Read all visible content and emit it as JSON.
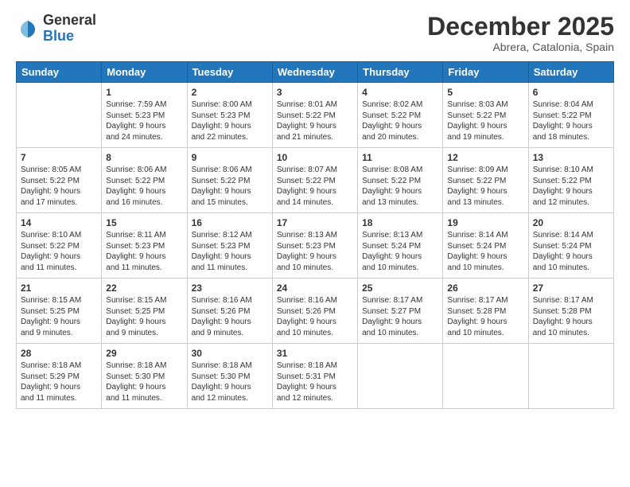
{
  "header": {
    "logo_general": "General",
    "logo_blue": "Blue",
    "month": "December 2025",
    "location": "Abrera, Catalonia, Spain"
  },
  "days_of_week": [
    "Sunday",
    "Monday",
    "Tuesday",
    "Wednesday",
    "Thursday",
    "Friday",
    "Saturday"
  ],
  "weeks": [
    [
      {
        "num": "",
        "info": ""
      },
      {
        "num": "1",
        "info": "Sunrise: 7:59 AM\nSunset: 5:23 PM\nDaylight: 9 hours\nand 24 minutes."
      },
      {
        "num": "2",
        "info": "Sunrise: 8:00 AM\nSunset: 5:23 PM\nDaylight: 9 hours\nand 22 minutes."
      },
      {
        "num": "3",
        "info": "Sunrise: 8:01 AM\nSunset: 5:22 PM\nDaylight: 9 hours\nand 21 minutes."
      },
      {
        "num": "4",
        "info": "Sunrise: 8:02 AM\nSunset: 5:22 PM\nDaylight: 9 hours\nand 20 minutes."
      },
      {
        "num": "5",
        "info": "Sunrise: 8:03 AM\nSunset: 5:22 PM\nDaylight: 9 hours\nand 19 minutes."
      },
      {
        "num": "6",
        "info": "Sunrise: 8:04 AM\nSunset: 5:22 PM\nDaylight: 9 hours\nand 18 minutes."
      }
    ],
    [
      {
        "num": "7",
        "info": "Sunrise: 8:05 AM\nSunset: 5:22 PM\nDaylight: 9 hours\nand 17 minutes."
      },
      {
        "num": "8",
        "info": "Sunrise: 8:06 AM\nSunset: 5:22 PM\nDaylight: 9 hours\nand 16 minutes."
      },
      {
        "num": "9",
        "info": "Sunrise: 8:06 AM\nSunset: 5:22 PM\nDaylight: 9 hours\nand 15 minutes."
      },
      {
        "num": "10",
        "info": "Sunrise: 8:07 AM\nSunset: 5:22 PM\nDaylight: 9 hours\nand 14 minutes."
      },
      {
        "num": "11",
        "info": "Sunrise: 8:08 AM\nSunset: 5:22 PM\nDaylight: 9 hours\nand 13 minutes."
      },
      {
        "num": "12",
        "info": "Sunrise: 8:09 AM\nSunset: 5:22 PM\nDaylight: 9 hours\nand 13 minutes."
      },
      {
        "num": "13",
        "info": "Sunrise: 8:10 AM\nSunset: 5:22 PM\nDaylight: 9 hours\nand 12 minutes."
      }
    ],
    [
      {
        "num": "14",
        "info": "Sunrise: 8:10 AM\nSunset: 5:22 PM\nDaylight: 9 hours\nand 11 minutes."
      },
      {
        "num": "15",
        "info": "Sunrise: 8:11 AM\nSunset: 5:23 PM\nDaylight: 9 hours\nand 11 minutes."
      },
      {
        "num": "16",
        "info": "Sunrise: 8:12 AM\nSunset: 5:23 PM\nDaylight: 9 hours\nand 11 minutes."
      },
      {
        "num": "17",
        "info": "Sunrise: 8:13 AM\nSunset: 5:23 PM\nDaylight: 9 hours\nand 10 minutes."
      },
      {
        "num": "18",
        "info": "Sunrise: 8:13 AM\nSunset: 5:24 PM\nDaylight: 9 hours\nand 10 minutes."
      },
      {
        "num": "19",
        "info": "Sunrise: 8:14 AM\nSunset: 5:24 PM\nDaylight: 9 hours\nand 10 minutes."
      },
      {
        "num": "20",
        "info": "Sunrise: 8:14 AM\nSunset: 5:24 PM\nDaylight: 9 hours\nand 10 minutes."
      }
    ],
    [
      {
        "num": "21",
        "info": "Sunrise: 8:15 AM\nSunset: 5:25 PM\nDaylight: 9 hours\nand 9 minutes."
      },
      {
        "num": "22",
        "info": "Sunrise: 8:15 AM\nSunset: 5:25 PM\nDaylight: 9 hours\nand 9 minutes."
      },
      {
        "num": "23",
        "info": "Sunrise: 8:16 AM\nSunset: 5:26 PM\nDaylight: 9 hours\nand 9 minutes."
      },
      {
        "num": "24",
        "info": "Sunrise: 8:16 AM\nSunset: 5:26 PM\nDaylight: 9 hours\nand 10 minutes."
      },
      {
        "num": "25",
        "info": "Sunrise: 8:17 AM\nSunset: 5:27 PM\nDaylight: 9 hours\nand 10 minutes."
      },
      {
        "num": "26",
        "info": "Sunrise: 8:17 AM\nSunset: 5:28 PM\nDaylight: 9 hours\nand 10 minutes."
      },
      {
        "num": "27",
        "info": "Sunrise: 8:17 AM\nSunset: 5:28 PM\nDaylight: 9 hours\nand 10 minutes."
      }
    ],
    [
      {
        "num": "28",
        "info": "Sunrise: 8:18 AM\nSunset: 5:29 PM\nDaylight: 9 hours\nand 11 minutes."
      },
      {
        "num": "29",
        "info": "Sunrise: 8:18 AM\nSunset: 5:30 PM\nDaylight: 9 hours\nand 11 minutes."
      },
      {
        "num": "30",
        "info": "Sunrise: 8:18 AM\nSunset: 5:30 PM\nDaylight: 9 hours\nand 12 minutes."
      },
      {
        "num": "31",
        "info": "Sunrise: 8:18 AM\nSunset: 5:31 PM\nDaylight: 9 hours\nand 12 minutes."
      },
      {
        "num": "",
        "info": ""
      },
      {
        "num": "",
        "info": ""
      },
      {
        "num": "",
        "info": ""
      }
    ]
  ]
}
